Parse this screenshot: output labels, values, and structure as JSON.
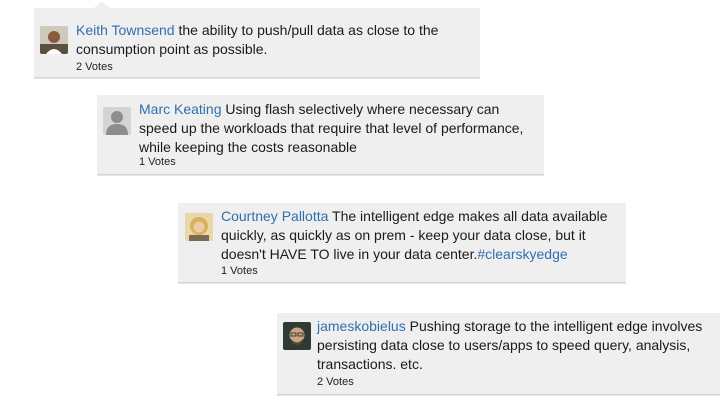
{
  "comments": [
    {
      "author": "Keith Townsend",
      "text": " the ability to push/pull data as close to the consumption point as possible.",
      "votes": "2 Votes",
      "avatar": "photo-avatar"
    },
    {
      "author": "Marc Keating",
      "text": " Using flash selectively where necessary can speed up the workloads that require that level of performance, while keeping the costs reasonable",
      "votes": "1 Votes",
      "avatar": "default-user-avatar"
    },
    {
      "author": "Courtney Pallotta",
      "text": " The intelligent edge makes all data available quickly, as quickly as on prem - keep your data close, but it doesn't HAVE TO live in your data center.",
      "hashtag": "#clearskyedge",
      "votes": "1 Votes",
      "avatar": "photo-avatar"
    },
    {
      "author": "jameskobielus",
      "text": " Pushing storage to the intelligent edge involves persisting data close to users/apps to speed query, analysis, transactions. etc.",
      "votes": "2 Votes",
      "avatar": "photo-avatar"
    }
  ],
  "colors": {
    "card_bg": "#efefef",
    "link": "#2f6fae",
    "text": "#1a1a1a"
  }
}
